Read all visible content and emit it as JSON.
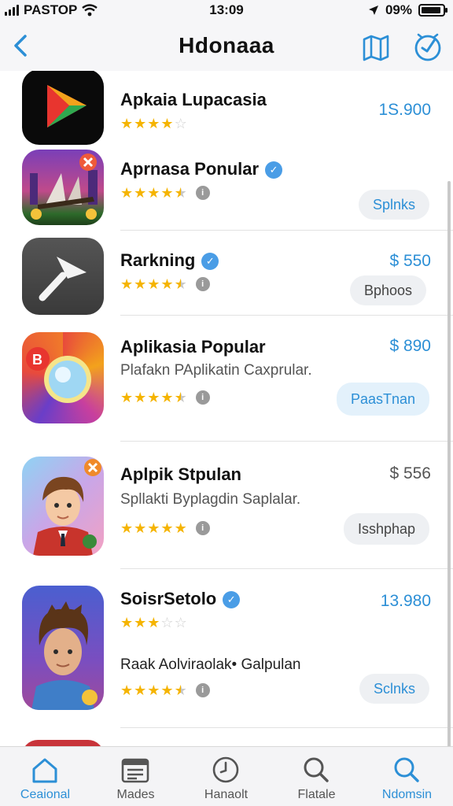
{
  "status_bar": {
    "carrier": "PASTOP",
    "time": "13:09",
    "battery": "09%"
  },
  "nav": {
    "title": "Hdonaaa"
  },
  "apps": [
    {
      "name": "Apkaia Lupacasia",
      "rating": 4,
      "action_type": "price",
      "price": "1S.900"
    },
    {
      "name": "Aprnasa Ponular",
      "verified": true,
      "rating": 4.5,
      "action_type": "button",
      "button": "Splnks"
    },
    {
      "name": "Rarkning",
      "verified": true,
      "rating": 4.5,
      "action_type": "both",
      "price": "$ 550",
      "button": "Bphoos"
    },
    {
      "name": "Aplikasia Popular",
      "subtitle": "Plafakn PAplikatin Caxprular.",
      "rating": 4.5,
      "action_type": "both",
      "price": "$ 890",
      "button": "PaasTnan"
    },
    {
      "name": "Aplpik Stpulan",
      "subtitle": "Spllakti Byplagdin Saplalar.",
      "rating": 5,
      "action_type": "both",
      "price": "$ 556",
      "button": "Isshphap"
    },
    {
      "name": "SoisrSetolo",
      "verified": true,
      "subtitle": "Raak Aolviraolak• Galpulan",
      "rating": 3,
      "rating2": 4.5,
      "action_type": "both",
      "price": "13.980",
      "button": "Sclnks"
    }
  ],
  "tabs": [
    {
      "label": "Ceaional",
      "icon": "home-icon",
      "active": true
    },
    {
      "label": "Mades",
      "icon": "list-icon"
    },
    {
      "label": "Hanaolt",
      "icon": "clock-icon"
    },
    {
      "label": "Flatale",
      "icon": "search-icon"
    },
    {
      "label": "Ndomsin",
      "icon": "search-icon",
      "active": true
    }
  ],
  "colors": {
    "accent": "#2c8fd6",
    "star": "#f5b400",
    "verified": "#4a9de6"
  }
}
